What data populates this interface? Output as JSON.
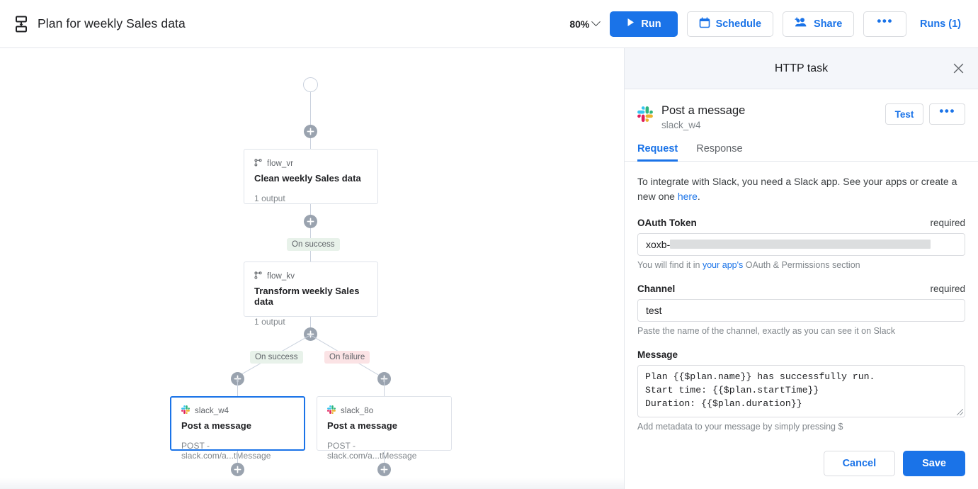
{
  "topbar": {
    "plan_icon": "plan-flow-icon",
    "title": "Plan for weekly Sales data",
    "zoom_level": "80%",
    "run_label": "Run",
    "run_icon": "play-icon",
    "schedule_label": "Schedule",
    "schedule_icon": "calendar-icon",
    "share_label": "Share",
    "share_icon": "add-people-icon",
    "more_label": "•••",
    "runs_label": "Runs (1)",
    "accent_color": "#1a73e8"
  },
  "canvas": {
    "start_node": "start-circle",
    "nodes": [
      {
        "id": "flow_vr",
        "icon": "flow-branch-icon",
        "title": "Clean weekly Sales data",
        "subtitle": "1 output",
        "selected": false
      },
      {
        "id": "flow_kv",
        "icon": "flow-branch-icon",
        "title": "Transform weekly Sales data",
        "subtitle": "1 output",
        "selected": false
      },
      {
        "id": "slack_w4",
        "icon": "slack-icon",
        "title": "Post a message",
        "subtitle": "POST - slack.com/a...tMessage",
        "selected": true
      },
      {
        "id": "slack_8o",
        "icon": "slack-icon",
        "title": "Post a message",
        "subtitle": "POST - slack.com/a...tMessage",
        "selected": false
      }
    ],
    "edge_labels": {
      "success_1": "On success",
      "success_2": "On success",
      "failure_1": "On failure"
    },
    "add_step_icon": "plus-circle-icon",
    "success_color": "#e8f2ea",
    "failure_color": "#fbe3e5"
  },
  "panel": {
    "header_title": "HTTP task",
    "close_icon": "close-icon",
    "task": {
      "icon": "slack-icon",
      "name": "Post a message",
      "id": "slack_w4",
      "test_label": "Test",
      "more_label": "•••"
    },
    "tabs": [
      {
        "label": "Request",
        "active": true
      },
      {
        "label": "Response",
        "active": false
      }
    ],
    "intro": {
      "text_before": "To integrate with Slack, you need a Slack app. See your apps or create a new one ",
      "link": "here",
      "text_after": "."
    },
    "fields": {
      "oauth": {
        "label": "OAuth Token",
        "required": "required",
        "value_prefix": "xoxb-",
        "value_redacted": true,
        "hint_before": "You will find it in ",
        "hint_link": "your app's",
        "hint_after": " OAuth & Permissions section"
      },
      "channel": {
        "label": "Channel",
        "required": "required",
        "value": "test",
        "hint": "Paste the name of the channel, exactly as you can see it on Slack"
      },
      "message": {
        "label": "Message",
        "value": "Plan {{$plan.name}} has successfully run.\nStart time: {{$plan.startTime}}\nDuration: {{$plan.duration}}",
        "hint": "Add metadata to your message by simply pressing $"
      }
    },
    "footer": {
      "cancel_label": "Cancel",
      "save_label": "Save"
    }
  }
}
